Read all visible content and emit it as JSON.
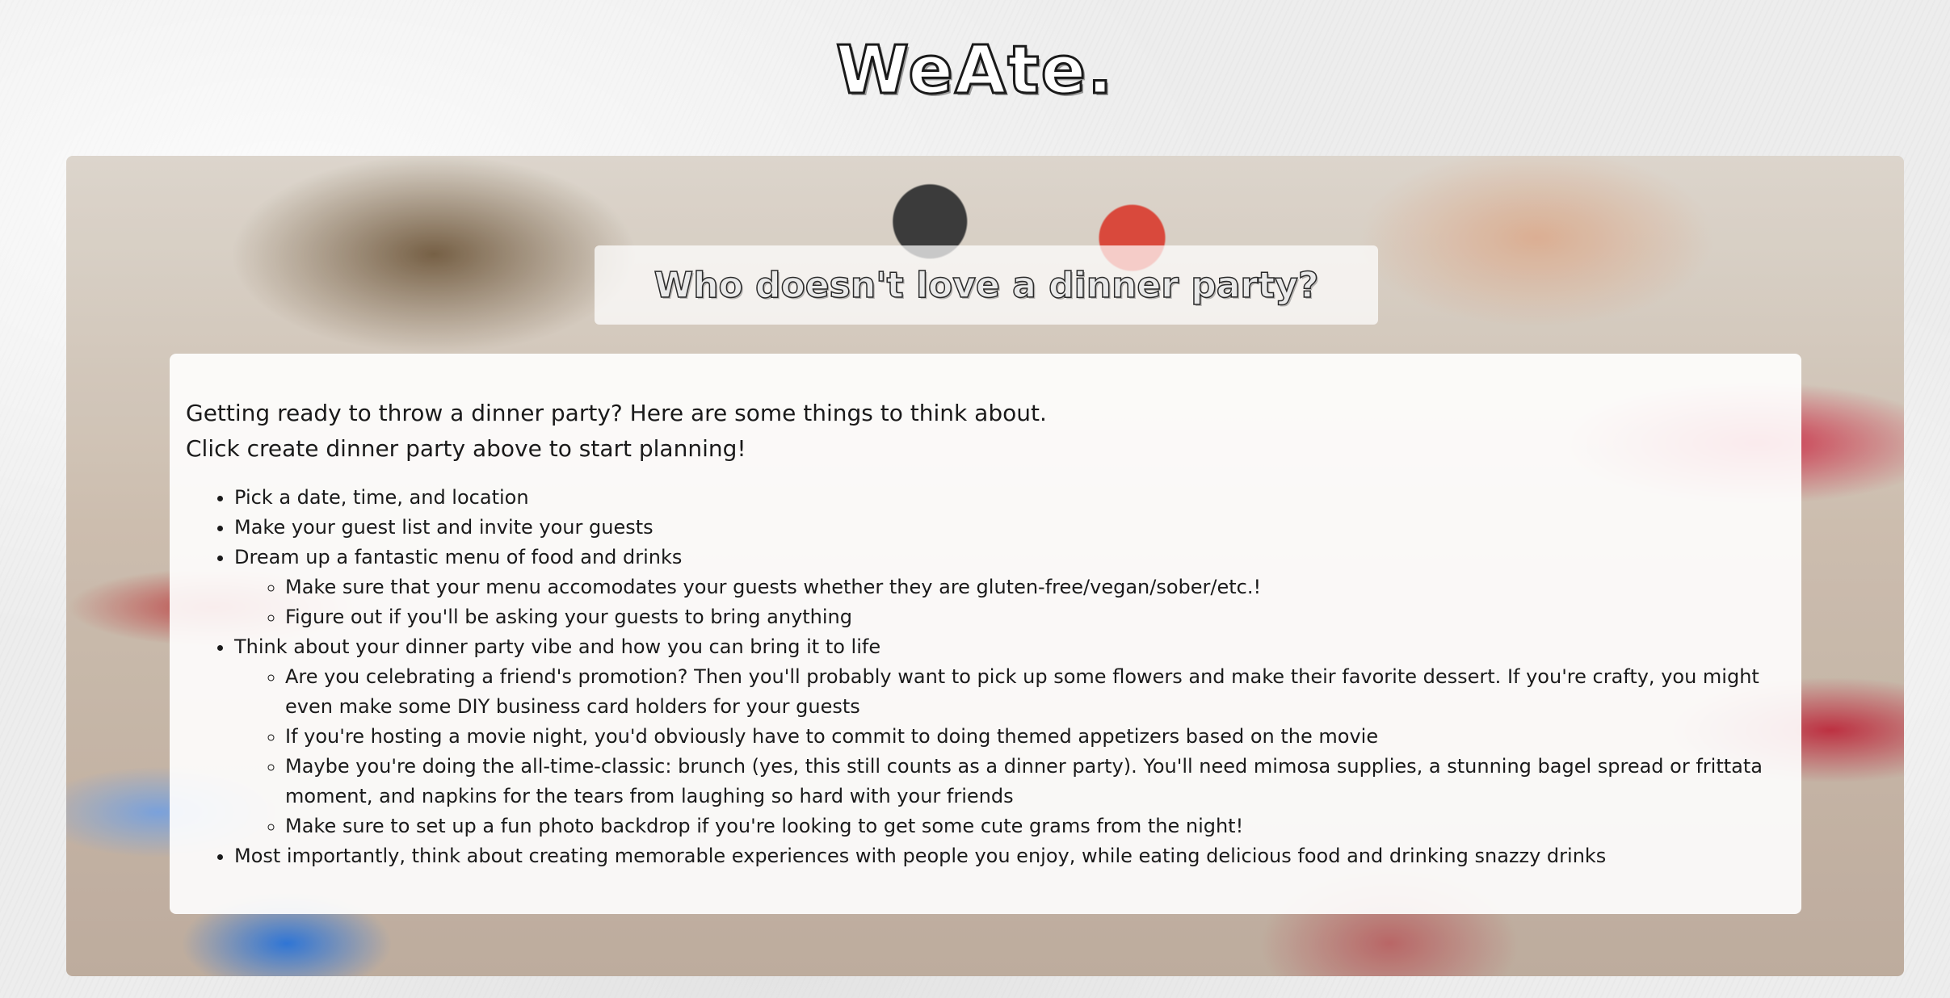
{
  "site": {
    "title": "WeAte."
  },
  "hero": {
    "heading": "Who doesn't love a dinner party?"
  },
  "content": {
    "intro_line_1": "Getting ready to throw a dinner party? Here are some things to think about.",
    "intro_line_2": "Click create dinner party above to start planning!",
    "list": [
      {
        "text": "Pick a date, time, and location",
        "sub": []
      },
      {
        "text": "Make your guest list and invite your guests",
        "sub": []
      },
      {
        "text": "Dream up a fantastic menu of food and drinks",
        "sub": [
          "Make sure that your menu accomodates your guests whether they are gluten-free/vegan/sober/etc.!",
          "Figure out if you'll be asking your guests to bring anything"
        ]
      },
      {
        "text": "Think about your dinner party vibe and how you can bring it to life",
        "sub": [
          "Are you celebrating a friend's promotion? Then you'll probably want to pick up some flowers and make their favorite dessert. If you're crafty, you might even make some DIY business card holders for your guests",
          "If you're hosting a movie night, you'd obviously have to commit to doing themed appetizers based on the movie",
          "Maybe you're doing the all-time-classic: brunch (yes, this still counts as a dinner party). You'll need mimosa supplies, a stunning bagel spread or frittata moment, and napkins for the tears from laughing so hard with your friends",
          "Make sure to set up a fun photo backdrop if you're looking to get some cute grams from the night!"
        ]
      },
      {
        "text": "Most importantly, think about creating memorable experiences with people you enjoy, while eating delicious food and drinking snazzy drinks",
        "sub": []
      }
    ]
  }
}
